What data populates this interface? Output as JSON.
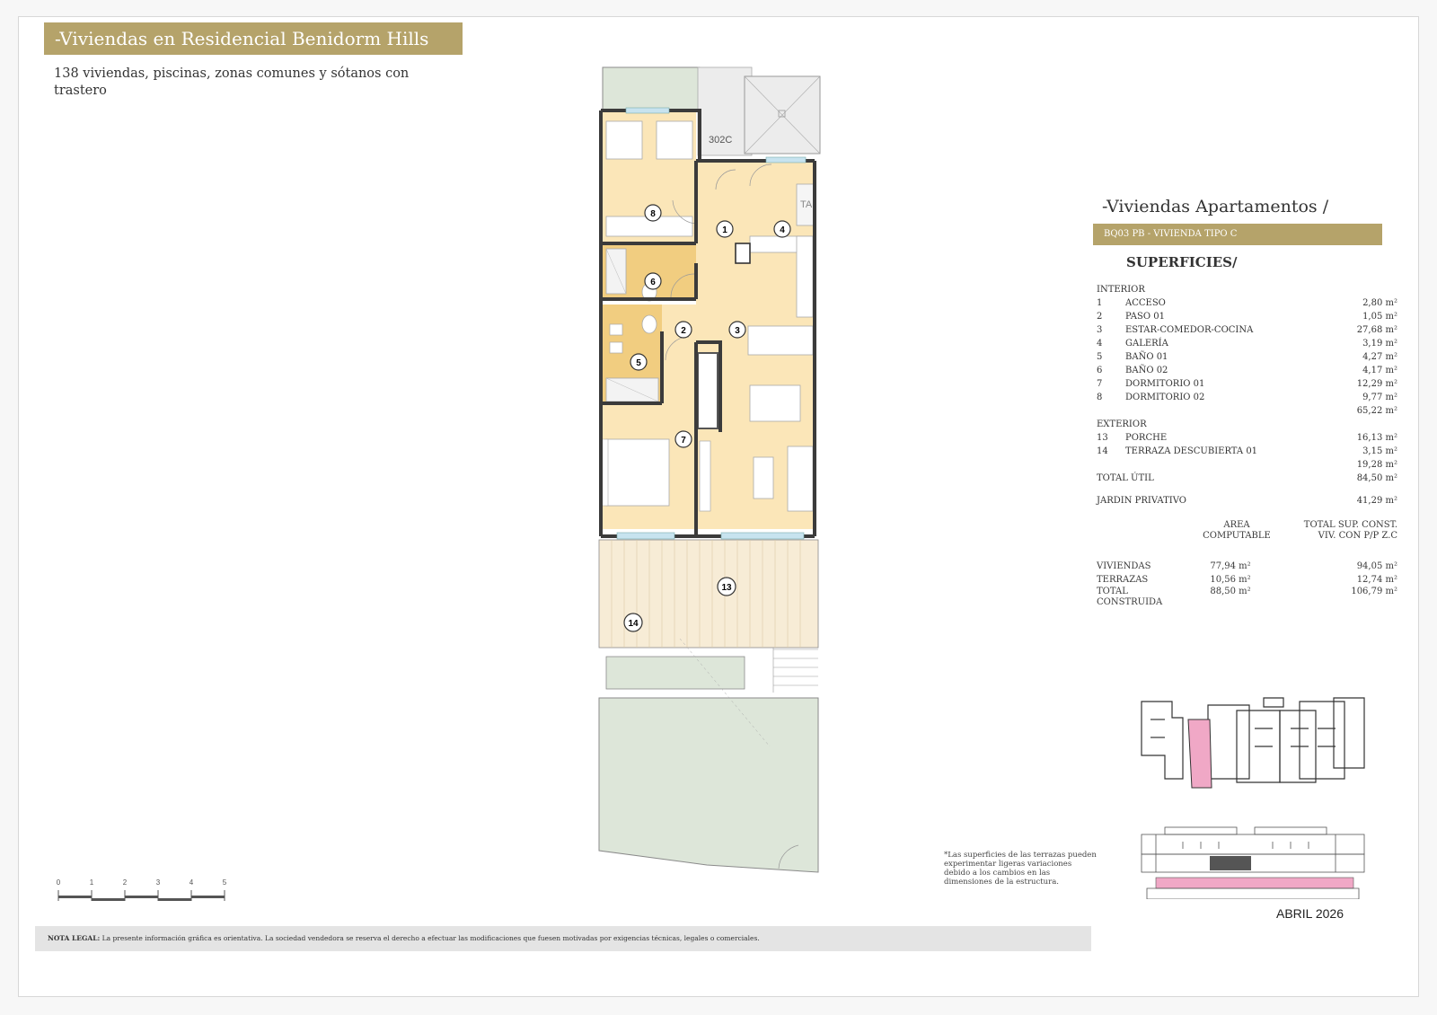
{
  "header": {
    "title": "-Viviendas en Residencial Benidorm Hills",
    "subtitle": "138 viviendas, piscinas, zonas comunes y sótanos con trastero"
  },
  "plan": {
    "unit_code": "302C",
    "room_numbers": [
      "1",
      "2",
      "3",
      "4",
      "5",
      "6",
      "7",
      "8",
      "13",
      "14"
    ],
    "appliance_label": "TA"
  },
  "panel": {
    "title": "-Viviendas Apartamentos /",
    "band": "BQ03 PB - VIVIENDA TIPO C",
    "subtitle": "SUPERFICIES/",
    "interior": {
      "heading": "INTERIOR",
      "rows": [
        {
          "n": "1",
          "label": "ACCESO",
          "value": "2,80 m²"
        },
        {
          "n": "2",
          "label": "PASO 01",
          "value": "1,05 m²"
        },
        {
          "n": "3",
          "label": "ESTAR-COMEDOR-COCINA",
          "value": "27,68 m²"
        },
        {
          "n": "4",
          "label": "GALERÍA",
          "value": "3,19 m²"
        },
        {
          "n": "5",
          "label": "BAÑO 01",
          "value": "4,27 m²"
        },
        {
          "n": "6",
          "label": "BAÑO 02",
          "value": "4,17 m²"
        },
        {
          "n": "7",
          "label": "DORMITORIO 01",
          "value": "12,29 m²"
        },
        {
          "n": "8",
          "label": "DORMITORIO 02",
          "value": "9,77 m²"
        }
      ],
      "subtotal": "65,22 m²"
    },
    "exterior": {
      "heading": "EXTERIOR",
      "rows": [
        {
          "n": "13",
          "label": "PORCHE",
          "value": "16,13 m²"
        },
        {
          "n": "14",
          "label": "TERRAZA DESCUBIERTA 01",
          "value": "3,15 m²"
        }
      ],
      "subtotal": "19,28 m²"
    },
    "total_util": {
      "label": "TOTAL ÚTIL",
      "value": "84,50 m²"
    },
    "jardin": {
      "label": "JARDIN PRIVATIVO",
      "value": "41,29 m²"
    },
    "summary": {
      "col1": "AREA COMPUTABLE",
      "col2": "TOTAL SUP. CONST. VIV. CON P/P Z.C",
      "rows": [
        {
          "label": "VIVIENDAS",
          "v1": "77,94 m²",
          "v2": "94,05 m²"
        },
        {
          "label": "TERRAZAS",
          "v1": "10,56 m²",
          "v2": "12,74 m²"
        },
        {
          "label": "TOTAL CONSTRUIDA",
          "v1": "88,50 m²",
          "v2": "106,79 m²"
        }
      ]
    }
  },
  "note": "*Las superficies de las terrazas pueden experimentar ligeras variaciones debido a los cambios en las dimensiones de la estructura.",
  "date": "ABRIL 2026",
  "legal": {
    "bold": "NOTA LEGAL:",
    "text": " La presente información gráfica es orientativa. La sociedad vendedora se reserva el derecho a efectuar las modificaciones que fuesen motivadas por exigencias técnicas, legales o comerciales."
  },
  "scale": {
    "ticks": [
      "0",
      "1",
      "2",
      "3",
      "4",
      "5"
    ]
  },
  "colors": {
    "gold": "#b5a36a",
    "room": "#fbe6b8",
    "bath": "#f1cd80",
    "garden": "#dde6d9",
    "highlight": "#f0a8c6"
  }
}
